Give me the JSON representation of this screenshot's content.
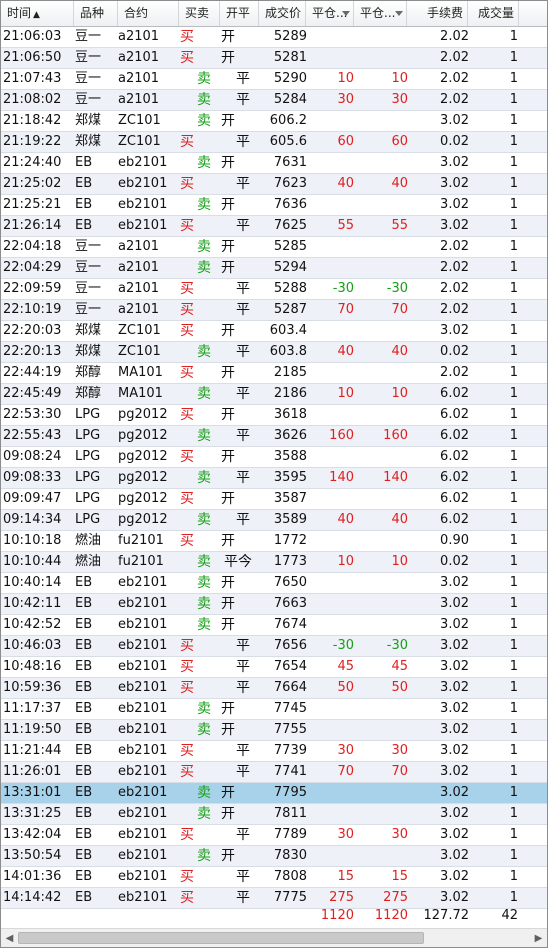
{
  "columns": {
    "time": "时间",
    "product": "品种",
    "contract": "合约",
    "side": "买卖",
    "open_close": "开平",
    "price": "成交价",
    "close_pnl_1": "平仓...",
    "close_pnl_2": "平仓...",
    "fee": "手续费",
    "qty": "成交量"
  },
  "sort_indicator": "▲",
  "rows": [
    {
      "time": "21:06:03",
      "product": "豆一",
      "contract": "a2101",
      "side": "买",
      "oc": "开",
      "price": "5289",
      "pnl1": "",
      "pnl2": "",
      "fee": "2.02",
      "qty": "1"
    },
    {
      "time": "21:06:50",
      "product": "豆一",
      "contract": "a2101",
      "side": "买",
      "oc": "开",
      "price": "5281",
      "pnl1": "",
      "pnl2": "",
      "fee": "2.02",
      "qty": "1"
    },
    {
      "time": "21:07:43",
      "product": "豆一",
      "contract": "a2101",
      "side": "卖",
      "oc": "平",
      "price": "5290",
      "pnl1": "10",
      "pnl2": "10",
      "fee": "2.02",
      "qty": "1"
    },
    {
      "time": "21:08:02",
      "product": "豆一",
      "contract": "a2101",
      "side": "卖",
      "oc": "平",
      "price": "5284",
      "pnl1": "30",
      "pnl2": "30",
      "fee": "2.02",
      "qty": "1"
    },
    {
      "time": "21:18:42",
      "product": "郑煤",
      "contract": "ZC101",
      "side": "卖",
      "oc": "开",
      "price": "606.2",
      "pnl1": "",
      "pnl2": "",
      "fee": "3.02",
      "qty": "1"
    },
    {
      "time": "21:19:22",
      "product": "郑煤",
      "contract": "ZC101",
      "side": "买",
      "oc": "平",
      "price": "605.6",
      "pnl1": "60",
      "pnl2": "60",
      "fee": "0.02",
      "qty": "1"
    },
    {
      "time": "21:24:40",
      "product": "EB",
      "contract": "eb2101",
      "side": "卖",
      "oc": "开",
      "price": "7631",
      "pnl1": "",
      "pnl2": "",
      "fee": "3.02",
      "qty": "1"
    },
    {
      "time": "21:25:02",
      "product": "EB",
      "contract": "eb2101",
      "side": "买",
      "oc": "平",
      "price": "7623",
      "pnl1": "40",
      "pnl2": "40",
      "fee": "3.02",
      "qty": "1"
    },
    {
      "time": "21:25:21",
      "product": "EB",
      "contract": "eb2101",
      "side": "卖",
      "oc": "开",
      "price": "7636",
      "pnl1": "",
      "pnl2": "",
      "fee": "3.02",
      "qty": "1"
    },
    {
      "time": "21:26:14",
      "product": "EB",
      "contract": "eb2101",
      "side": "买",
      "oc": "平",
      "price": "7625",
      "pnl1": "55",
      "pnl2": "55",
      "fee": "3.02",
      "qty": "1"
    },
    {
      "time": "22:04:18",
      "product": "豆一",
      "contract": "a2101",
      "side": "卖",
      "oc": "开",
      "price": "5285",
      "pnl1": "",
      "pnl2": "",
      "fee": "2.02",
      "qty": "1"
    },
    {
      "time": "22:04:29",
      "product": "豆一",
      "contract": "a2101",
      "side": "卖",
      "oc": "开",
      "price": "5294",
      "pnl1": "",
      "pnl2": "",
      "fee": "2.02",
      "qty": "1"
    },
    {
      "time": "22:09:59",
      "product": "豆一",
      "contract": "a2101",
      "side": "买",
      "oc": "平",
      "price": "5288",
      "pnl1": "-30",
      "pnl2": "-30",
      "fee": "2.02",
      "qty": "1"
    },
    {
      "time": "22:10:19",
      "product": "豆一",
      "contract": "a2101",
      "side": "买",
      "oc": "平",
      "price": "5287",
      "pnl1": "70",
      "pnl2": "70",
      "fee": "2.02",
      "qty": "1"
    },
    {
      "time": "22:20:03",
      "product": "郑煤",
      "contract": "ZC101",
      "side": "买",
      "oc": "开",
      "price": "603.4",
      "pnl1": "",
      "pnl2": "",
      "fee": "3.02",
      "qty": "1"
    },
    {
      "time": "22:20:13",
      "product": "郑煤",
      "contract": "ZC101",
      "side": "卖",
      "oc": "平",
      "price": "603.8",
      "pnl1": "40",
      "pnl2": "40",
      "fee": "0.02",
      "qty": "1"
    },
    {
      "time": "22:44:19",
      "product": "郑醇",
      "contract": "MA101",
      "side": "买",
      "oc": "开",
      "price": "2185",
      "pnl1": "",
      "pnl2": "",
      "fee": "2.02",
      "qty": "1"
    },
    {
      "time": "22:45:49",
      "product": "郑醇",
      "contract": "MA101",
      "side": "卖",
      "oc": "平",
      "price": "2186",
      "pnl1": "10",
      "pnl2": "10",
      "fee": "6.02",
      "qty": "1"
    },
    {
      "time": "22:53:30",
      "product": "LPG",
      "contract": "pg2012",
      "side": "买",
      "oc": "开",
      "price": "3618",
      "pnl1": "",
      "pnl2": "",
      "fee": "6.02",
      "qty": "1"
    },
    {
      "time": "22:55:43",
      "product": "LPG",
      "contract": "pg2012",
      "side": "卖",
      "oc": "平",
      "price": "3626",
      "pnl1": "160",
      "pnl2": "160",
      "fee": "6.02",
      "qty": "1"
    },
    {
      "time": "09:08:24",
      "product": "LPG",
      "contract": "pg2012",
      "side": "买",
      "oc": "开",
      "price": "3588",
      "pnl1": "",
      "pnl2": "",
      "fee": "6.02",
      "qty": "1"
    },
    {
      "time": "09:08:33",
      "product": "LPG",
      "contract": "pg2012",
      "side": "卖",
      "oc": "平",
      "price": "3595",
      "pnl1": "140",
      "pnl2": "140",
      "fee": "6.02",
      "qty": "1"
    },
    {
      "time": "09:09:47",
      "product": "LPG",
      "contract": "pg2012",
      "side": "买",
      "oc": "开",
      "price": "3587",
      "pnl1": "",
      "pnl2": "",
      "fee": "6.02",
      "qty": "1"
    },
    {
      "time": "09:14:34",
      "product": "LPG",
      "contract": "pg2012",
      "side": "卖",
      "oc": "平",
      "price": "3589",
      "pnl1": "40",
      "pnl2": "40",
      "fee": "6.02",
      "qty": "1"
    },
    {
      "time": "10:10:18",
      "product": "燃油",
      "contract": "fu2101",
      "side": "买",
      "oc": "开",
      "price": "1772",
      "pnl1": "",
      "pnl2": "",
      "fee": "0.90",
      "qty": "1"
    },
    {
      "time": "10:10:44",
      "product": "燃油",
      "contract": "fu2101",
      "side": "卖",
      "oc": "平今",
      "price": "1773",
      "pnl1": "10",
      "pnl2": "10",
      "fee": "0.02",
      "qty": "1"
    },
    {
      "time": "10:40:14",
      "product": "EB",
      "contract": "eb2101",
      "side": "卖",
      "oc": "开",
      "price": "7650",
      "pnl1": "",
      "pnl2": "",
      "fee": "3.02",
      "qty": "1"
    },
    {
      "time": "10:42:11",
      "product": "EB",
      "contract": "eb2101",
      "side": "卖",
      "oc": "开",
      "price": "7663",
      "pnl1": "",
      "pnl2": "",
      "fee": "3.02",
      "qty": "1"
    },
    {
      "time": "10:42:52",
      "product": "EB",
      "contract": "eb2101",
      "side": "卖",
      "oc": "开",
      "price": "7674",
      "pnl1": "",
      "pnl2": "",
      "fee": "3.02",
      "qty": "1"
    },
    {
      "time": "10:46:03",
      "product": "EB",
      "contract": "eb2101",
      "side": "买",
      "oc": "平",
      "price": "7656",
      "pnl1": "-30",
      "pnl2": "-30",
      "fee": "3.02",
      "qty": "1"
    },
    {
      "time": "10:48:16",
      "product": "EB",
      "contract": "eb2101",
      "side": "买",
      "oc": "平",
      "price": "7654",
      "pnl1": "45",
      "pnl2": "45",
      "fee": "3.02",
      "qty": "1"
    },
    {
      "time": "10:59:36",
      "product": "EB",
      "contract": "eb2101",
      "side": "买",
      "oc": "平",
      "price": "7664",
      "pnl1": "50",
      "pnl2": "50",
      "fee": "3.02",
      "qty": "1"
    },
    {
      "time": "11:17:37",
      "product": "EB",
      "contract": "eb2101",
      "side": "卖",
      "oc": "开",
      "price": "7745",
      "pnl1": "",
      "pnl2": "",
      "fee": "3.02",
      "qty": "1"
    },
    {
      "time": "11:19:50",
      "product": "EB",
      "contract": "eb2101",
      "side": "卖",
      "oc": "开",
      "price": "7755",
      "pnl1": "",
      "pnl2": "",
      "fee": "3.02",
      "qty": "1"
    },
    {
      "time": "11:21:44",
      "product": "EB",
      "contract": "eb2101",
      "side": "买",
      "oc": "平",
      "price": "7739",
      "pnl1": "30",
      "pnl2": "30",
      "fee": "3.02",
      "qty": "1"
    },
    {
      "time": "11:26:01",
      "product": "EB",
      "contract": "eb2101",
      "side": "买",
      "oc": "平",
      "price": "7741",
      "pnl1": "70",
      "pnl2": "70",
      "fee": "3.02",
      "qty": "1"
    },
    {
      "time": "13:31:01",
      "product": "EB",
      "contract": "eb2101",
      "side": "卖",
      "oc": "开",
      "price": "7795",
      "pnl1": "",
      "pnl2": "",
      "fee": "3.02",
      "qty": "1"
    },
    {
      "time": "13:31:25",
      "product": "EB",
      "contract": "eb2101",
      "side": "卖",
      "oc": "开",
      "price": "7811",
      "pnl1": "",
      "pnl2": "",
      "fee": "3.02",
      "qty": "1"
    },
    {
      "time": "13:42:04",
      "product": "EB",
      "contract": "eb2101",
      "side": "买",
      "oc": "平",
      "price": "7789",
      "pnl1": "30",
      "pnl2": "30",
      "fee": "3.02",
      "qty": "1"
    },
    {
      "time": "13:50:54",
      "product": "EB",
      "contract": "eb2101",
      "side": "卖",
      "oc": "开",
      "price": "7830",
      "pnl1": "",
      "pnl2": "",
      "fee": "3.02",
      "qty": "1"
    },
    {
      "time": "14:01:36",
      "product": "EB",
      "contract": "eb2101",
      "side": "买",
      "oc": "平",
      "price": "7808",
      "pnl1": "15",
      "pnl2": "15",
      "fee": "3.02",
      "qty": "1"
    },
    {
      "time": "14:14:42",
      "product": "EB",
      "contract": "eb2101",
      "side": "买",
      "oc": "平",
      "price": "7775",
      "pnl1": "275",
      "pnl2": "275",
      "fee": "3.02",
      "qty": "1"
    }
  ],
  "selected_row_index": 36,
  "totals": {
    "pnl1": "1120",
    "pnl2": "1120",
    "fee": "127.72",
    "qty": "42"
  },
  "buy_label": "买",
  "sell_label": "卖",
  "colors": {
    "profit": "#e02020",
    "loss": "#16a016",
    "buy": "#e02020",
    "sell": "#16a016",
    "selected_row": "#a8d2ea",
    "alt_row": "#eef1f7"
  },
  "icons": {
    "header_sort": "sort-ascending-icon",
    "header_dropdown": "chevron-down-icon",
    "scroll_left": "arrow-left-icon",
    "scroll_right": "arrow-right-icon"
  }
}
